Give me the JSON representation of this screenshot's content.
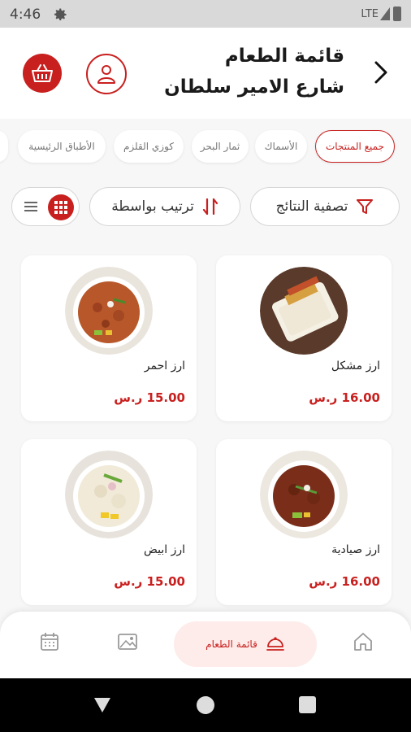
{
  "status_bar": {
    "time": "4:46",
    "network": "LTE",
    "icons": [
      "settings-gear-icon",
      "signal-icon",
      "battery-icon"
    ]
  },
  "header": {
    "title": "قائمة الطعام",
    "subtitle": "شارع الامير سلطان",
    "icons": [
      "chevron-right-icon",
      "user-icon",
      "basket-icon"
    ]
  },
  "categories": [
    {
      "label": "جميع المنتجات",
      "active": true
    },
    {
      "label": "الأسماك",
      "active": false
    },
    {
      "label": "ثمار البحر",
      "active": false
    },
    {
      "label": "كوزي القلزم",
      "active": false
    },
    {
      "label": "الأطباق الرئيسية",
      "active": false
    }
  ],
  "filters": {
    "filter_label": "تصفية النتائج",
    "sort_label": "ترتيب بواسطة",
    "view_modes": [
      "list",
      "grid"
    ],
    "active_view": "grid"
  },
  "products": [
    {
      "name": "ارز مشكل",
      "price": "16.00",
      "currency": "ر.س"
    },
    {
      "name": "ارز احمر",
      "price": "15.00",
      "currency": "ر.س"
    },
    {
      "name": "ارز صيادية",
      "price": "16.00",
      "currency": "ر.س"
    },
    {
      "name": "ارز ابيض",
      "price": "15.00",
      "currency": "ر.س"
    }
  ],
  "bottom_nav": {
    "items": [
      "home-icon",
      "menu-icon",
      "gallery-icon",
      "calendar-icon"
    ],
    "active_label": "قائمة الطعام"
  },
  "colors": {
    "accent": "#c8201f",
    "active_nav_bg": "#fdecea",
    "background": "#f7f7f7"
  }
}
